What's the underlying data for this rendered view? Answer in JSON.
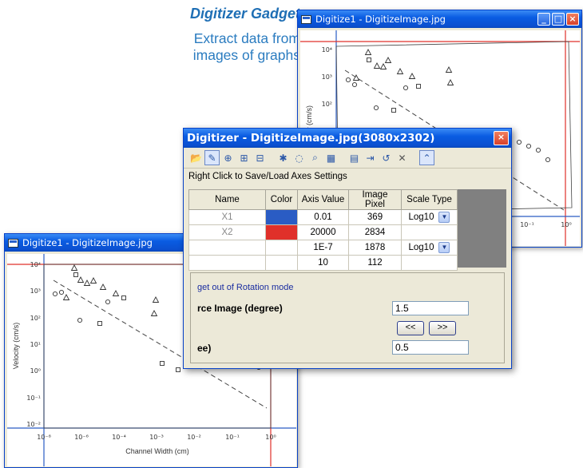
{
  "promo": {
    "title": "Digitizer Gadget",
    "subtitle_line1": "Extract data from",
    "subtitle_line2": "images of graphs"
  },
  "back_window": {
    "title": "Digitize1 - DigitizeImage.jpg"
  },
  "front_window": {
    "title": "Digitize1 - DigitizeImage.jpg"
  },
  "dialog": {
    "title": "Digitizer - DigitizeImage.jpg(3080x2302)",
    "hint": "Right Click to Save/Load Axes Settings",
    "table": {
      "headers": [
        "Name",
        "Color",
        "Axis Value",
        "Image Pixel",
        "Scale Type"
      ],
      "rows": [
        {
          "name": "X1",
          "color": "#2a5cc4",
          "axis_value": "0.01",
          "image_pixel": "369",
          "scale_type": "Log10"
        },
        {
          "name": "X2",
          "color": "#e0302a",
          "axis_value": "20000",
          "image_pixel": "2834",
          "scale_type": ""
        },
        {
          "name": "",
          "color": "",
          "axis_value": "1E-7",
          "image_pixel": "1878",
          "scale_type": "Log10"
        },
        {
          "name": "",
          "color": "",
          "axis_value": "10",
          "image_pixel": "112",
          "scale_type": ""
        }
      ]
    },
    "rotation": {
      "hint": "get out of Rotation mode",
      "angle_label": "rce Image (degree)",
      "angle_value": "1.5",
      "prev_label": "<<",
      "next_label": ">>",
      "step_label": "ee)",
      "step_value": "0.5"
    }
  },
  "front_plot": {
    "y_axis_label": "Velocity (cm/s)",
    "x_axis_label": "Channel Width (cm)",
    "y_ticks": [
      "10⁴",
      "10³",
      "10²",
      "10¹",
      "10⁰",
      "10⁻¹",
      "10⁻²"
    ],
    "x_ticks": [
      "10⁻⁸",
      "10⁻⁶",
      "10⁻⁴",
      "10⁻³",
      "10⁻²",
      "10⁻¹",
      "10⁰"
    ]
  },
  "back_plot": {
    "y_axis_label": "y (cm/s)",
    "y_ticks": [
      "10⁴",
      "10³",
      "10²",
      "10¹"
    ],
    "x_ticks": [
      "10⁻¹",
      "10⁰"
    ]
  }
}
